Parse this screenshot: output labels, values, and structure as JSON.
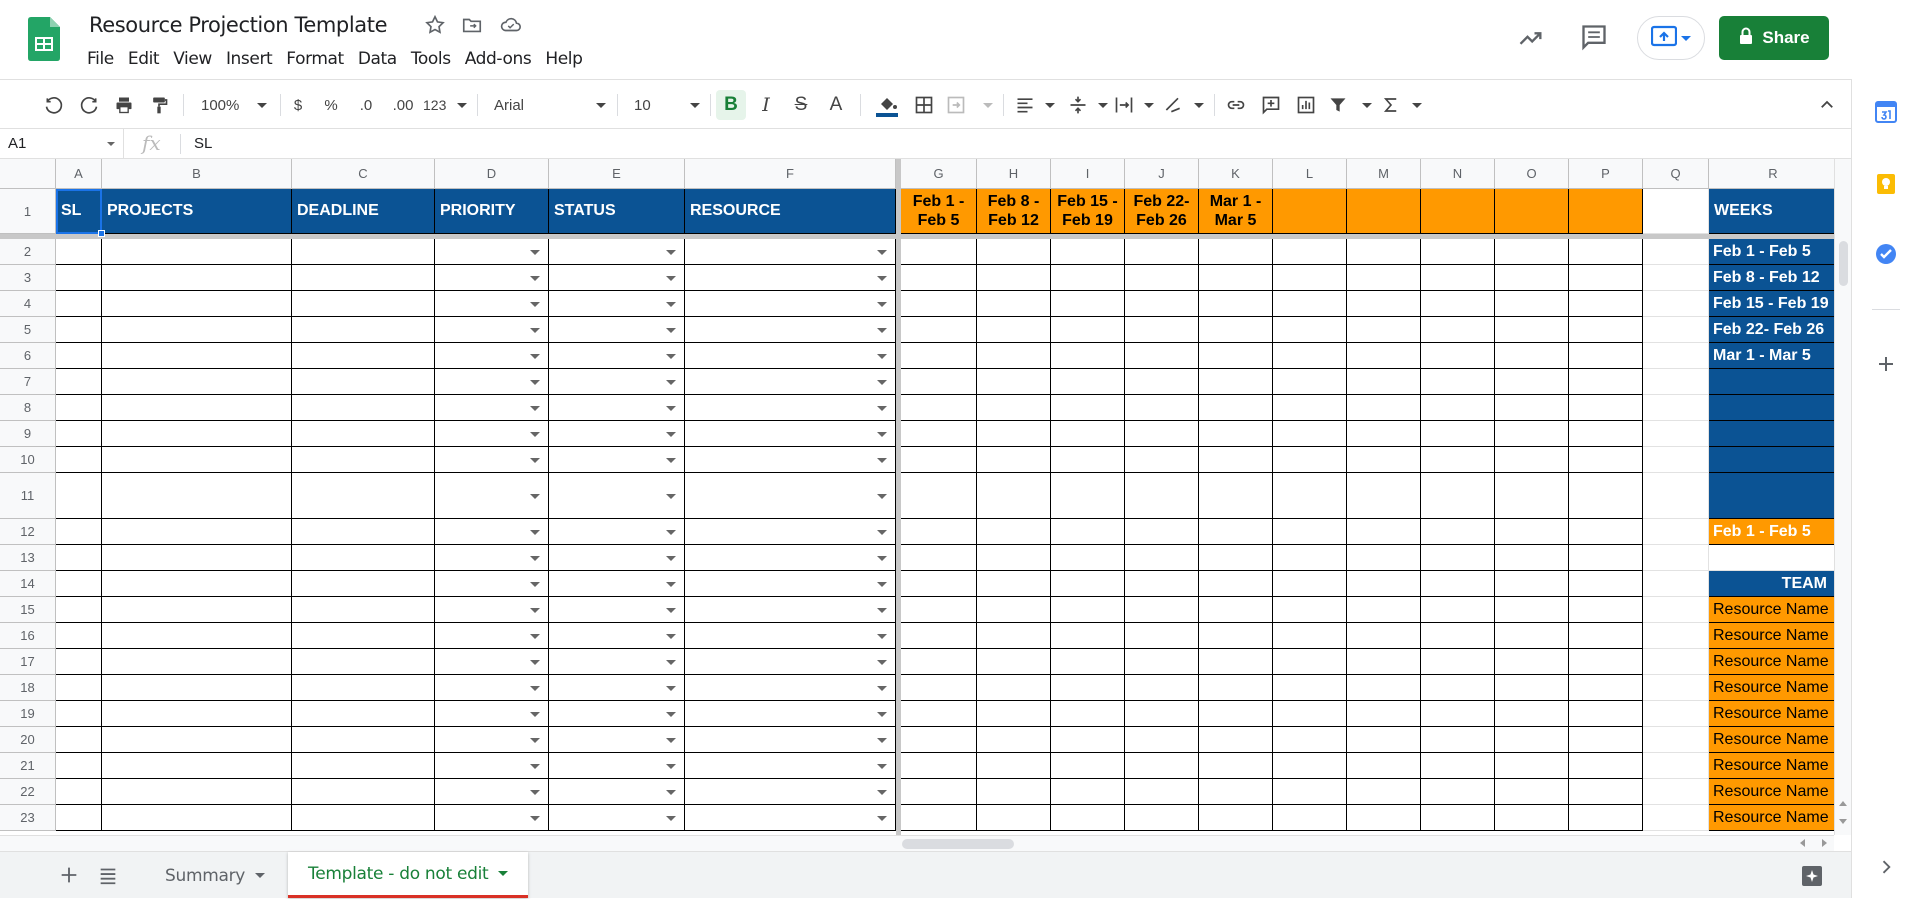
{
  "app": {
    "title": "Resource Projection Template",
    "share_label": "Share",
    "menu": [
      "File",
      "Edit",
      "View",
      "Insert",
      "Format",
      "Data",
      "Tools",
      "Add-ons",
      "Help"
    ]
  },
  "toolbar": {
    "zoom": "100%",
    "currency": "$",
    "percent": "%",
    "dec_less": ".0",
    "dec_more": ".00",
    "more_formats": "123",
    "font": "Arial",
    "font_size": "10",
    "bold": "B",
    "italic": "I",
    "strike": "S",
    "text_color": "A"
  },
  "formula": {
    "namebox": "A1",
    "fx": "fx",
    "value": "SL"
  },
  "columns": [
    "A",
    "B",
    "C",
    "D",
    "E",
    "F",
    "G",
    "H",
    "I",
    "J",
    "K",
    "L",
    "M",
    "N",
    "O",
    "P",
    "Q",
    "R"
  ],
  "rows": [
    "1",
    "2",
    "3",
    "4",
    "5",
    "6",
    "7",
    "8",
    "9",
    "10",
    "11",
    "12",
    "13",
    "14",
    "15",
    "16",
    "17",
    "18",
    "19",
    "20",
    "21",
    "22",
    "23"
  ],
  "header_row": {
    "sl": "SL",
    "projects": "PROJECTS",
    "deadline": "DEADLINE",
    "priority": "PRIORITY",
    "status": "STATUS",
    "resource": "RESOURCE",
    "weeks": [
      {
        "line1": "Feb 1 -",
        "line2": "Feb 5"
      },
      {
        "line1": "Feb 8 -",
        "line2": "Feb 12"
      },
      {
        "line1": "Feb 15 -",
        "line2": "Feb 19"
      },
      {
        "line1": "Feb 22-",
        "line2": "Feb 26"
      },
      {
        "line1": "Mar 1 -",
        "line2": "Mar 5"
      }
    ],
    "weeks_title": "WEEKS"
  },
  "weeks_list": [
    "Feb 1 - Feb 5",
    "Feb 8 - Feb 12",
    "Feb 15 - Feb 19",
    "Feb 22- Feb 26",
    "Mar 1 - Mar 5"
  ],
  "selected_week": "Feb 1 - Feb 5",
  "team_title": "TEAM",
  "resource_label": "Resource Name",
  "sheets": {
    "summary": "Summary",
    "template": "Template - do not edit"
  },
  "colors": {
    "header_blue": "#0b5394",
    "header_orange": "#ff9900",
    "share_green": "#188038",
    "active_tab": "#188038",
    "active_tab_underline": "#d93025"
  }
}
